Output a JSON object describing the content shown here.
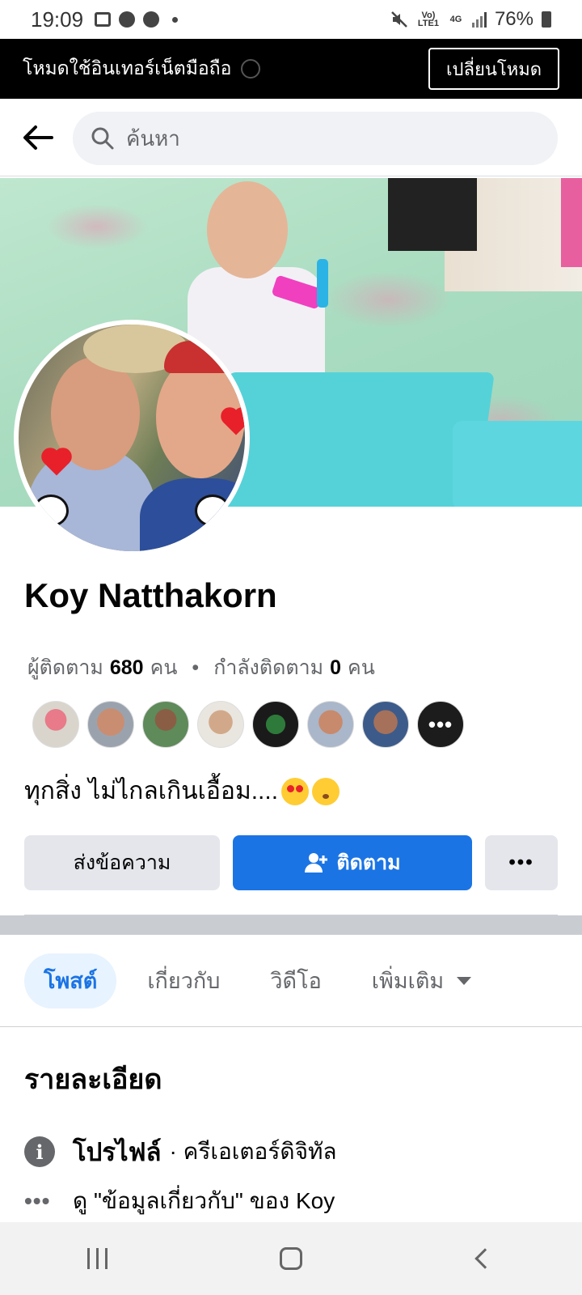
{
  "status_bar": {
    "time": "19:09",
    "network_label": "Vo) LTE1",
    "network_type": "4G",
    "battery": "76%"
  },
  "data_banner": {
    "text": "โหมดใช้อินเทอร์เน็ตมือถือ",
    "button": "เปลี่ยนโหมด"
  },
  "search": {
    "placeholder": "ค้นหา"
  },
  "profile": {
    "name": "Koy Natthakorn",
    "followers_label": "ผู้ติดตาม",
    "followers_count": "680",
    "followers_unit": "คน",
    "following_label": "กำลังติดตาม",
    "following_count": "0",
    "following_unit": "คน",
    "bio": "ทุกสิ่ง ไม่ไกลเกินเอื้อม....",
    "follower_avatar_count": 7,
    "follower_more_label": "•••"
  },
  "actions": {
    "message": "ส่งข้อความ",
    "follow": "ติดตาม",
    "more": "•••"
  },
  "tabs": [
    {
      "label": "โพสต์",
      "active": true
    },
    {
      "label": "เกี่ยวกับ",
      "active": false
    },
    {
      "label": "วิดีโอ",
      "active": false
    },
    {
      "label": "เพิ่มเติม",
      "active": false
    }
  ],
  "details": {
    "title": "รายละเอียด",
    "profile_label": "โปรไฟล์",
    "profile_value": "· ครีเอเตอร์ดิจิทัล",
    "about_link": "ดู \"ข้อมูลเกี่ยวกับ\" ของ Koy"
  },
  "colors": {
    "accent": "#1b74e4",
    "tab_active_bg": "#e7f3ff",
    "secondary_button": "#e4e6eb"
  }
}
